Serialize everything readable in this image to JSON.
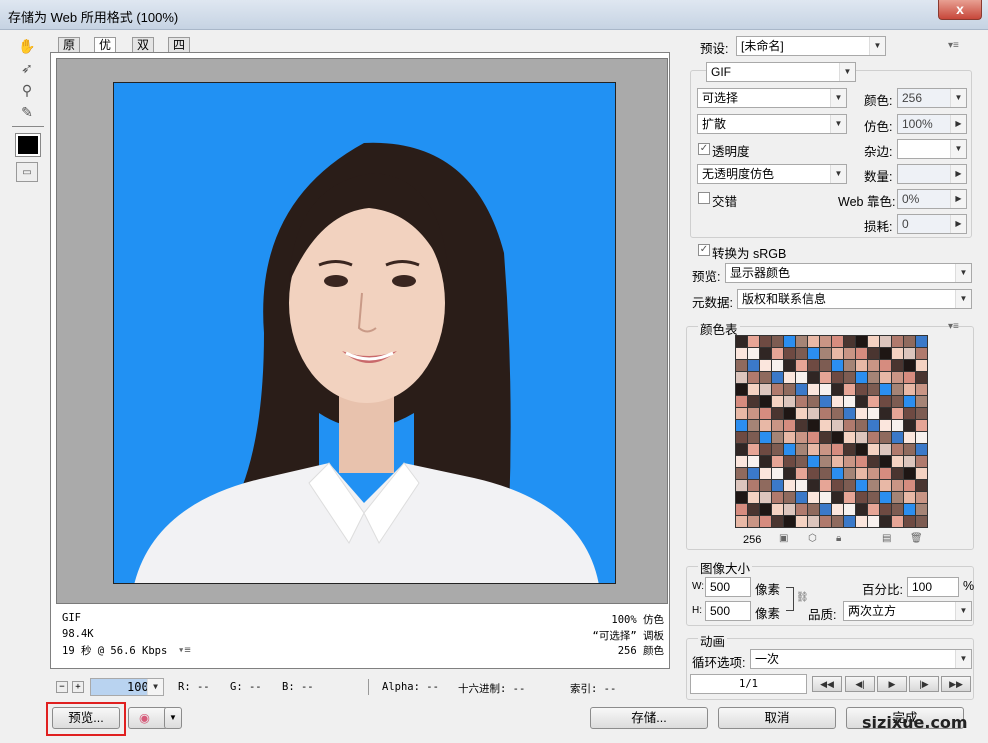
{
  "window": {
    "title": "存储为 Web 所用格式 (100%)",
    "close": "x"
  },
  "tools": [
    "hand-tool-icon",
    "slice-select-icon",
    "zoom-icon",
    "eyedropper-icon"
  ],
  "tabs": [
    "原稿",
    "优化",
    "双联",
    "四联"
  ],
  "active_tab": 1,
  "info": {
    "format": "GIF",
    "size": "98.4K",
    "time": "19 秒 @ 56.6 Kbps",
    "dither": "100% 仿色",
    "palette": "“可选择” 调板",
    "colors": "256 颜色",
    "menu": "▾≡"
  },
  "zoombar": {
    "zoom": "100%",
    "r": "R: --",
    "g": "G: --",
    "b": "B: --",
    "alpha": "Alpha: --",
    "hex": "十六进制: --",
    "index": "索引: --",
    "minus": "−",
    "plus": "+"
  },
  "settings": {
    "preset_label": "预设:",
    "preset": "[未命名]",
    "format": "GIF",
    "reduction": "可选择",
    "dither_algo": "扩散",
    "transparency_label": "透明度",
    "transparency_dither": "无透明度仿色",
    "interlace_label": "交错",
    "colors_label": "颜色:",
    "colors": "256",
    "dither_label": "仿色:",
    "dither": "100%",
    "matte_label": "杂边:",
    "amount_label": "数量:",
    "websnap_label": "Web 靠色:",
    "websnap": "0%",
    "lossy_label": "损耗:",
    "lossy": "0",
    "srgb_label": "转换为 sRGB",
    "preview_label": "预览:",
    "preview": "显示器颜色",
    "metadata_label": "元数据:",
    "metadata": "版权和联系信息"
  },
  "color_table": {
    "title": "颜色表",
    "count": "256"
  },
  "image_size": {
    "title": "图像大小",
    "w_label": "W:",
    "w": "500",
    "h_label": "H:",
    "h": "500",
    "unit": "像素",
    "percent_label": "百分比:",
    "percent": "100",
    "percent_unit": "%",
    "quality_label": "品质:",
    "quality": "两次立方"
  },
  "animation": {
    "title": "动画",
    "loop_label": "循环选项:",
    "loop": "一次",
    "frame": "1/1"
  },
  "buttons": {
    "preview": "预览...",
    "save": "存储...",
    "cancel": "取消",
    "done": "完成"
  },
  "watermark": "sizixue.com"
}
